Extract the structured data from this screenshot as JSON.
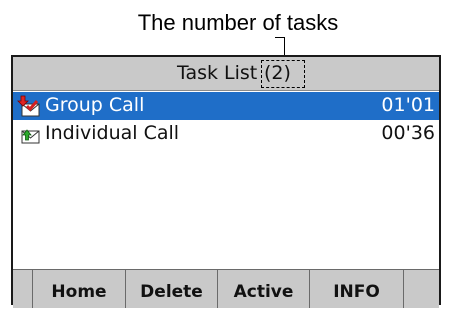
{
  "annotation": {
    "label": "The number of tasks"
  },
  "header": {
    "title": "Task List",
    "count": "(2)"
  },
  "tasks": [
    {
      "name": "Group Call",
      "time": "01'01",
      "icon": "group-call-icon",
      "selected": true
    },
    {
      "name": "Individual Call",
      "time": "00'36",
      "icon": "individual-call-icon",
      "selected": false
    }
  ],
  "softkeys": [
    {
      "label": "Home"
    },
    {
      "label": "Delete"
    },
    {
      "label": "Active"
    },
    {
      "label": "INFO"
    }
  ],
  "colors": {
    "selection": "#1f6ec8",
    "bar": "#c9c9c9"
  }
}
